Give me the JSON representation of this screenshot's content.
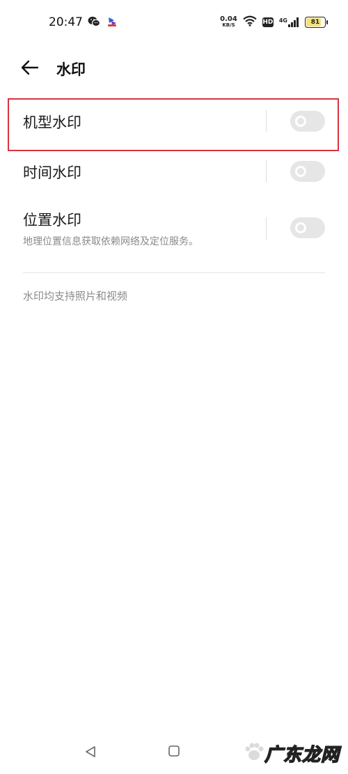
{
  "status_bar": {
    "time": "20:47",
    "left_icons": [
      "wechat-icon",
      "app-notification-icon"
    ],
    "net_speed_value": "0.04",
    "net_speed_unit": "KB/S",
    "hd": "HD",
    "network": "4G",
    "battery_level": "81",
    "battery_fill_percent": 81
  },
  "header": {
    "back_icon": "arrow-left-icon",
    "title": "水印"
  },
  "settings": [
    {
      "label": "机型水印",
      "subtitle": "",
      "enabled": false
    },
    {
      "label": "时间水印",
      "subtitle": "",
      "enabled": false
    },
    {
      "label": "位置水印",
      "subtitle": "地理位置信息获取依赖网络及定位服务。",
      "enabled": false
    }
  ],
  "footnote": "水印均支持照片和视频",
  "nav_bar": {
    "icons": [
      "nav-back-icon",
      "nav-home-icon"
    ]
  },
  "watermark": {
    "logo_text": "广东龙网"
  },
  "colors": {
    "highlight": "#d8323f",
    "toggle_off": "#e6e6e6",
    "battery_fill": "#f3e27a"
  }
}
